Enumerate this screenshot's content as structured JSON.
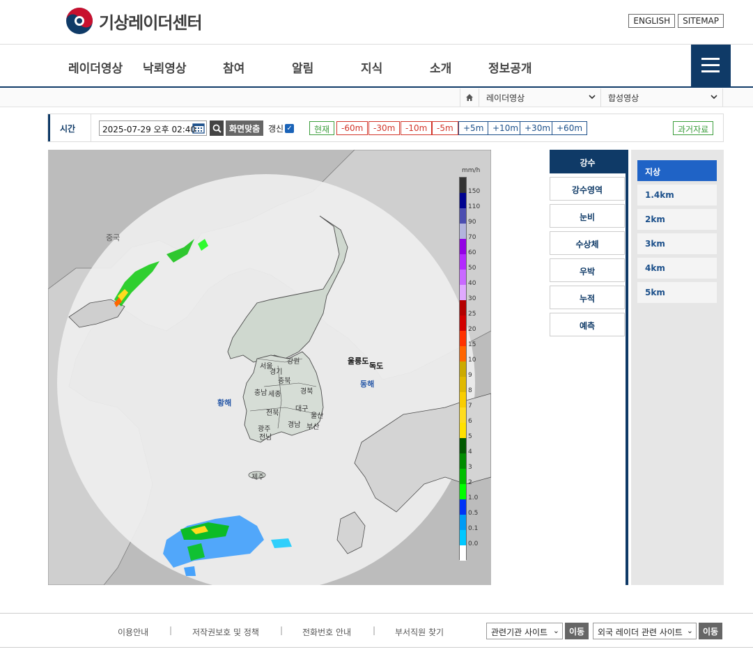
{
  "header": {
    "site_title": "기상레이더센터",
    "lang_buttons": [
      "ENGLISH",
      "SITEMAP"
    ]
  },
  "nav": {
    "items": [
      "레이더영상",
      "낙뢰영상",
      "참여",
      "알림",
      "지식",
      "소개",
      "정보공개"
    ]
  },
  "breadcrumb": {
    "level1": "레이더영상",
    "level2": "합성영상"
  },
  "timebar": {
    "label": "시간",
    "datetime_value": "2025-07-29 오후 02:40",
    "fit_label": "화면맞춤",
    "refresh_label": "갱신",
    "refresh_checked": true,
    "now_label": "현재",
    "minus_buttons": [
      "-60m",
      "-30m",
      "-10m",
      "-5m"
    ],
    "plus_buttons": [
      "+5m",
      "+10m",
      "+30m",
      "+60m"
    ],
    "past_label": "과거자료"
  },
  "map": {
    "labels": {
      "china": "중국",
      "yellow_sea": "황해",
      "east_sea": "동해",
      "ulleungdo": "울릉도",
      "dokdo": "독도",
      "seoul": "서울",
      "gyeonggi": "경기",
      "gangwon": "강원",
      "chungbuk": "충북",
      "chungnam": "충남",
      "sejong": "세종",
      "gyeongbuk": "경북",
      "daegu": "대구",
      "jeonbuk": "전북",
      "ulsan": "울산",
      "gwangju": "광주",
      "gyeongnam": "경남",
      "busan": "부산",
      "jeonnam": "전남",
      "jeju": "제주"
    },
    "legend": {
      "unit": "mm/h",
      "levels": [
        "150",
        "110",
        "90",
        "70",
        "60",
        "50",
        "40",
        "30",
        "25",
        "20",
        "15",
        "10",
        "9",
        "8",
        "7",
        "6",
        "5",
        "4",
        "3",
        "2",
        "1.0",
        "0.5",
        "0.1",
        "0.0"
      ],
      "colors": [
        "#333333",
        "#000390",
        "#4c4eb1",
        "#b3b4de",
        "#9300e4",
        "#b329ff",
        "#c969ff",
        "#e0a9ff",
        "#b40000",
        "#d20000",
        "#ff3200",
        "#ff6600",
        "#ccaa00",
        "#e0b900",
        "#f9cd00",
        "#ffdc1f",
        "#ffe100",
        "#005a00",
        "#008c00",
        "#00be00",
        "#00ff00",
        "#0033f5",
        "#009bf5",
        "#00c8ff",
        "#ffffff"
      ]
    }
  },
  "panel_type": {
    "header": "강수",
    "items": [
      "강수영역",
      "눈비",
      "수상체",
      "우박",
      "누적",
      "예측"
    ]
  },
  "panel_altitude": {
    "items": [
      "지상",
      "1.4km",
      "2km",
      "3km",
      "4km",
      "5km"
    ],
    "active_index": 0
  },
  "footer": {
    "links": [
      "이용안내",
      "저작권보호 및 정책",
      "전화번호 안내",
      "부서직원 찾기"
    ],
    "select1": "관련기관 사이트",
    "select2": "외국 레이더 관련 사이트",
    "go_label": "이동"
  }
}
